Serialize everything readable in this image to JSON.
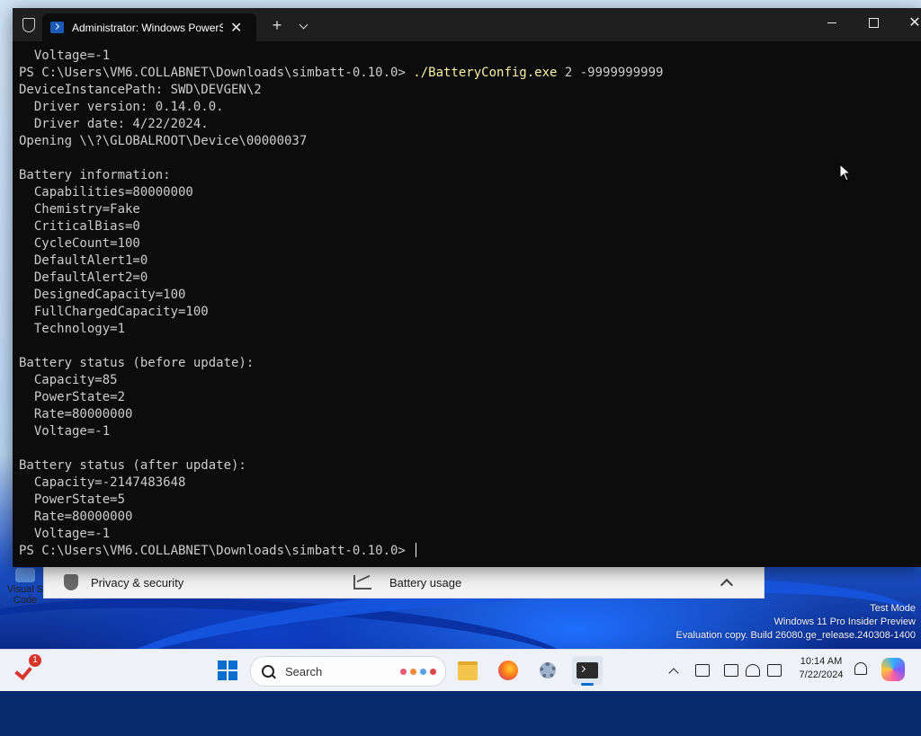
{
  "terminal": {
    "tab_title": "Administrator: Windows PowerShell",
    "tab_close_glyph": "✕",
    "new_tab_glyph": "+",
    "close_glyph": "✕",
    "lines": [
      {
        "text": "  Voltage=-1"
      },
      {
        "prompt": "PS C:\\Users\\VM6.COLLABNET\\Downloads\\simbatt-0.10.0> ",
        "cmd": "./BatteryConfig.exe",
        "args": " 2 -9999999999"
      },
      {
        "text": "DeviceInstancePath: SWD\\DEVGEN\\2"
      },
      {
        "text": "  Driver version: 0.14.0.0."
      },
      {
        "text": "  Driver date: 4/22/2024."
      },
      {
        "text": "Opening \\\\?\\GLOBALROOT\\Device\\00000037"
      },
      {
        "text": ""
      },
      {
        "text": "Battery information:"
      },
      {
        "text": "  Capabilities=80000000"
      },
      {
        "text": "  Chemistry=Fake"
      },
      {
        "text": "  CriticalBias=0"
      },
      {
        "text": "  CycleCount=100"
      },
      {
        "text": "  DefaultAlert1=0"
      },
      {
        "text": "  DefaultAlert2=0"
      },
      {
        "text": "  DesignedCapacity=100"
      },
      {
        "text": "  FullChargedCapacity=100"
      },
      {
        "text": "  Technology=1"
      },
      {
        "text": ""
      },
      {
        "text": "Battery status (before update):"
      },
      {
        "text": "  Capacity=85"
      },
      {
        "text": "  PowerState=2"
      },
      {
        "text": "  Rate=80000000"
      },
      {
        "text": "  Voltage=-1"
      },
      {
        "text": ""
      },
      {
        "text": "Battery status (after update):"
      },
      {
        "text": "  Capacity=-2147483648"
      },
      {
        "text": "  PowerState=5"
      },
      {
        "text": "  Rate=80000000"
      },
      {
        "text": "  Voltage=-1"
      },
      {
        "text": "PS C:\\Users\\VM6.COLLABNET\\Downloads\\simbatt-0.10.0> "
      }
    ]
  },
  "settings_window": {
    "left_item": "Privacy & security",
    "right_item": "Battery usage"
  },
  "desktop": {
    "icon_label_line1": "Visual S",
    "icon_label_line2": "Code"
  },
  "watermark": {
    "line1": "Test Mode",
    "line2": "Windows 11 Pro Insider Preview",
    "line3": "Evaluation copy. Build 26080.ge_release.240308-1400"
  },
  "taskbar": {
    "notification_badge": "1",
    "search_label": "Search",
    "time": "10:14 AM",
    "date": "7/22/2024",
    "accent_color": "#0a6ed1"
  }
}
